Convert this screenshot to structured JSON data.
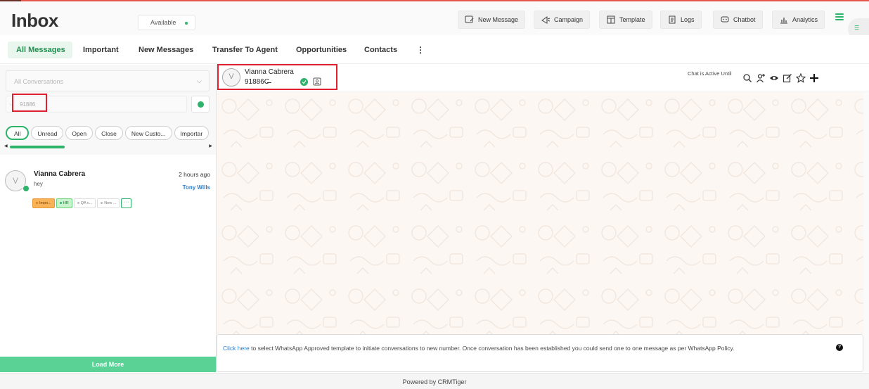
{
  "header": {
    "title": "Inbox",
    "status": "Available",
    "buttons": [
      {
        "label": "New Message",
        "icon": "new-message-icon"
      },
      {
        "label": "Campaign",
        "icon": "campaign-icon"
      },
      {
        "label": "Template",
        "icon": "template-icon"
      },
      {
        "label": "Logs",
        "icon": "logs-icon"
      },
      {
        "label": "Chatbot",
        "icon": "chatbot-icon"
      },
      {
        "label": "Analytics",
        "icon": "analytics-icon"
      }
    ]
  },
  "tabs": [
    "All Messages",
    "Important",
    "New Messages",
    "Transfer To Agent",
    "Opportunities",
    "Contacts"
  ],
  "tab_more": "⋮",
  "sidebar": {
    "conversation_filter": "All Conversations",
    "search_value": "91886",
    "pills": [
      "All",
      "Unread",
      "Open",
      "Close",
      "New Custo...",
      "Importar"
    ],
    "conversations": [
      {
        "name": "Vianna Cabrera",
        "time": "2 hours ago",
        "message": "hey",
        "agent": "Tony Wills",
        "avatar_letter": "V",
        "tags": [
          "Impo...",
          "HR",
          "QA c...",
          "New ..."
        ]
      }
    ],
    "load_more": "Load More"
  },
  "chat": {
    "contact_name": "Vianna Cabrera",
    "contact_phone": "91886C̶̶̶̶̶̶",
    "avatar_letter": "V",
    "active_label": "Chat is Active Until",
    "composer_link": "Click here",
    "composer_text": " to select WhatsApp Approved template to initiate conversations to new number. Once conversation has been established you could send one to one message as per WhatsApp Policy."
  },
  "footer": "Powered by CRMTiger",
  "colors": {
    "accent": "#2db36a",
    "link": "#2b7fd1",
    "highlight": "#e0202e"
  }
}
